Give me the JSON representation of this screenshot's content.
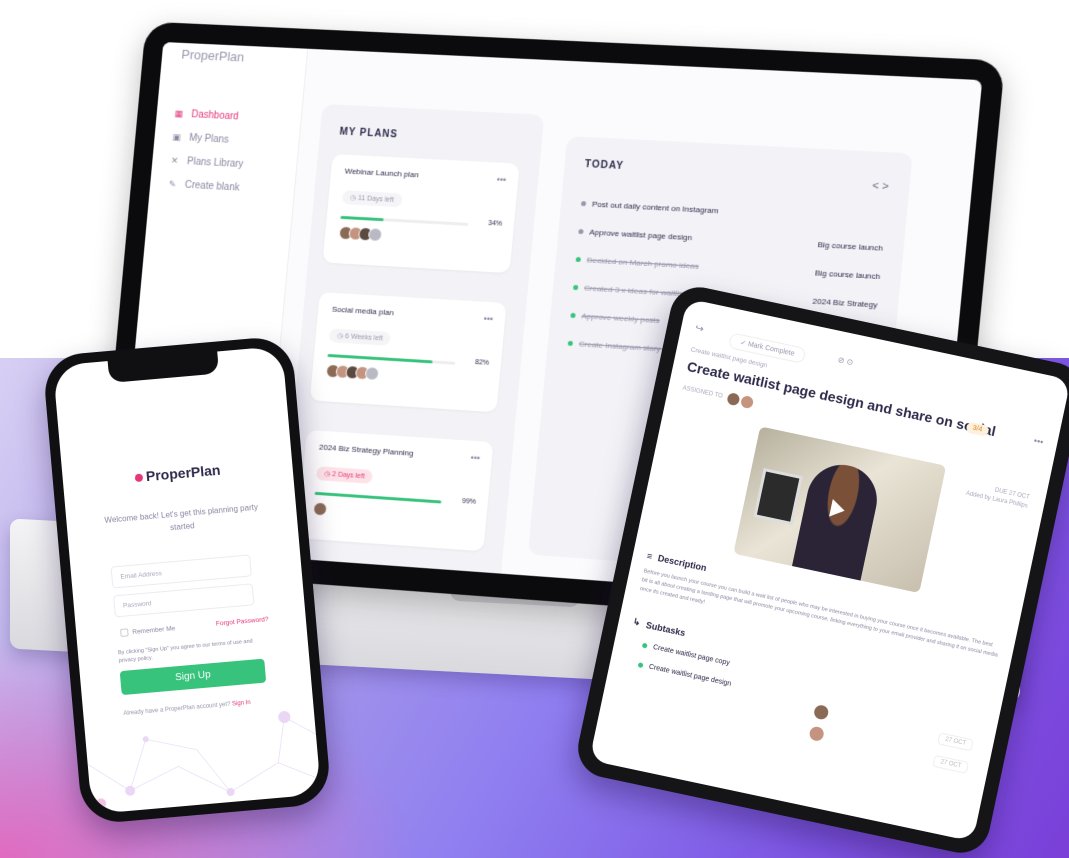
{
  "laptop": {
    "logo": "ProperPlan",
    "nav": [
      {
        "label": "Dashboard",
        "icon": "dashboard-icon",
        "active": true
      },
      {
        "label": "My Plans",
        "icon": "plans-icon",
        "active": false
      },
      {
        "label": "Plans Library",
        "icon": "library-icon",
        "active": false
      },
      {
        "label": "Create blank",
        "icon": "pencil-icon",
        "active": false
      }
    ],
    "my_plans": {
      "title": "MY PLANS",
      "cards": [
        {
          "name": "Webinar Launch plan",
          "chip": "11 Days left",
          "progress": 0.34,
          "pct": "34%",
          "avatars": 4
        },
        {
          "name": "Social media plan",
          "chip": "6 Weeks left",
          "progress": 0.82,
          "pct": "82%",
          "avatars": 5
        },
        {
          "name": "2024 Biz Strategy Planning",
          "chip": "2 Days left",
          "progress": 0.99,
          "pct": "99%",
          "avatars": 1
        }
      ]
    },
    "today": {
      "title": "TODAY",
      "nav": "< >",
      "tasks": [
        {
          "name": "Post out daily content on Instagram",
          "plan": "",
          "done": false
        },
        {
          "name": "Approve waitlist page design",
          "plan": "Big course launch",
          "done": false
        },
        {
          "name": "Decided on March promo ideas",
          "plan": "Big course launch",
          "done": true
        },
        {
          "name": "Created 3 x ideas for waitlist bonuses",
          "plan": "2024 Biz Strategy",
          "done": true
        },
        {
          "name": "Approve weekly posts",
          "plan": "2024 Biz Strategy",
          "done": true
        },
        {
          "name": "Create Instagram story poll",
          "plan": "",
          "done": true
        }
      ]
    }
  },
  "phone": {
    "logo": "ProperPlan",
    "welcome": "Welcome back! Let's get this planning party started",
    "email_placeholder": "Email Address",
    "password_placeholder": "Password",
    "remember": "Remember Me",
    "forgot": "Forgot Password?",
    "terms": "By clicking \"Sign Up\" you agree to our terms of use and privacy policy.",
    "signup": "Sign Up",
    "already": "Already have a ProperPlan account yet?",
    "signin": "Sign In"
  },
  "tablet": {
    "mark_complete": "Mark Complete",
    "breadcrumb": "Create waitlist page design",
    "title": "Create waitlist page design and share on social",
    "assigned_to": "ASSIGNED TO",
    "badge": "3/4",
    "due_label": "DUE",
    "due_date": "27 OCT",
    "added_by": "Added by Laura Phillips",
    "description_title": "Description",
    "description": "Before you launch your course you can build a wait list of people who may be interested in buying your course once it becomes available. The best bit is all about creating a landing page that will promote your upcoming course, linking everything to your email provider and sharing it on social media once its created and ready!",
    "subtasks_title": "Subtasks",
    "subtasks": [
      "Create waitlist page copy",
      "Create waitlist page design"
    ],
    "dates": [
      "27 OCT",
      "27 OCT"
    ]
  },
  "colors": {
    "accent_pink": "#e4377a",
    "accent_green": "#37c37c",
    "bg_purple": "#7d55e4"
  }
}
